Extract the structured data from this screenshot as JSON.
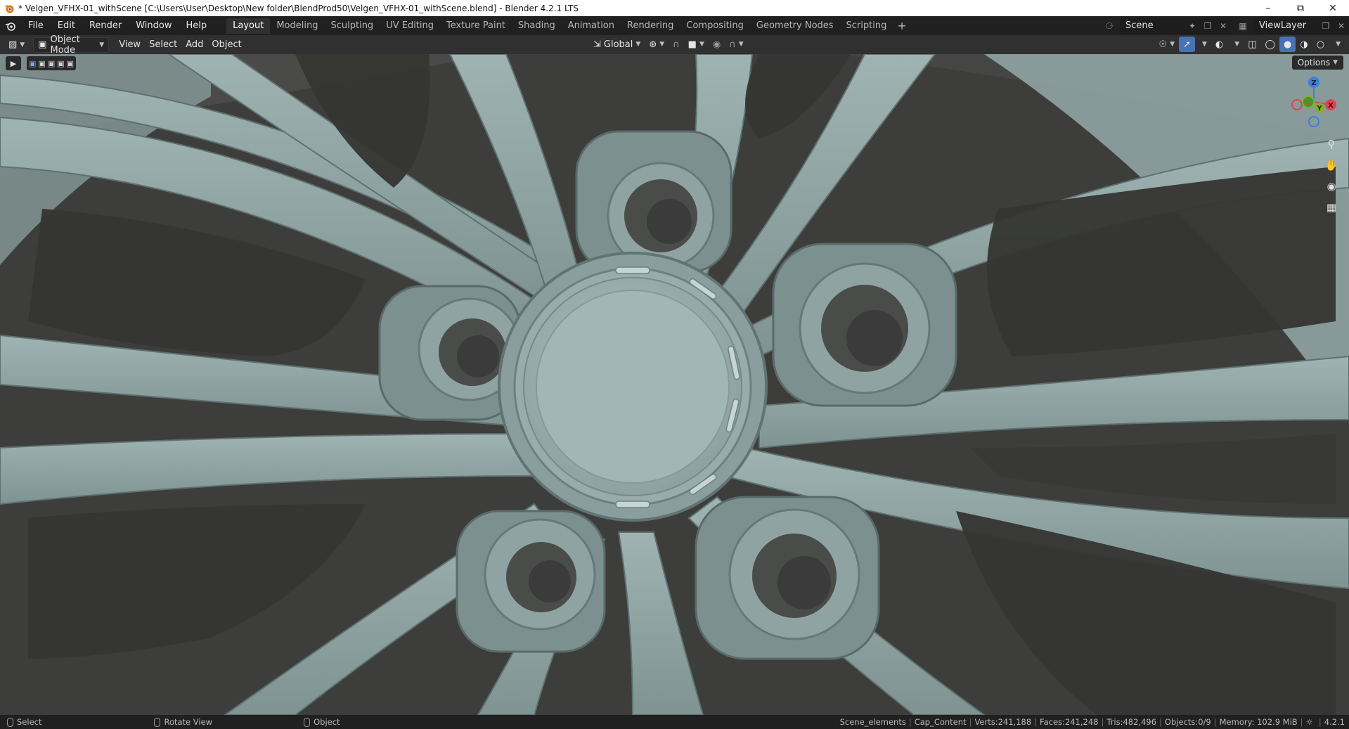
{
  "window": {
    "title": "* Velgen_VFHX-01_withScene [C:\\Users\\User\\Desktop\\New folder\\BlendProd50\\Velgen_VFHX-01_withScene.blend] - Blender 4.2.1 LTS",
    "icons": {
      "app": "blender-app-icon",
      "minimize": "minimize-icon",
      "restore": "restore-icon",
      "close": "close-icon"
    }
  },
  "topbar": {
    "menus": [
      "File",
      "Edit",
      "Render",
      "Window",
      "Help"
    ],
    "workspaces": [
      "Layout",
      "Modeling",
      "Sculpting",
      "UV Editing",
      "Texture Paint",
      "Shading",
      "Animation",
      "Rendering",
      "Compositing",
      "Geometry Nodes",
      "Scripting"
    ],
    "active_workspace": "Layout",
    "add_workspace": "+",
    "scene": {
      "label": "Scene"
    },
    "view_layer": {
      "label": "ViewLayer"
    }
  },
  "viewport_header": {
    "mode": "Object Mode",
    "menus": [
      "View",
      "Select",
      "Add",
      "Object"
    ],
    "transform_orientation": "Global",
    "options": "Options"
  },
  "gizmo": {
    "x": "X",
    "y": "Y",
    "z": "Z"
  },
  "statusbar": {
    "left": [
      {
        "label": "Select"
      },
      {
        "label": "Rotate View"
      },
      {
        "label": "Object"
      }
    ],
    "stats": {
      "collection": "Scene_elements",
      "active": "Cap_Content",
      "verts": "Verts:241,188",
      "faces": "Faces:241,248",
      "tris": "Tris:482,496",
      "objects": "Objects:0/9",
      "memory": "Memory: 102.9 MiB",
      "version": "4.2.1"
    }
  },
  "colors": {
    "accent": "#4772b3",
    "rim_metal": "#8fa3a3",
    "rim_dark": "#3a3a38",
    "gizmo_x": "#e0414f",
    "gizmo_y": "#7fb02c",
    "gizmo_z": "#3d80d8"
  }
}
